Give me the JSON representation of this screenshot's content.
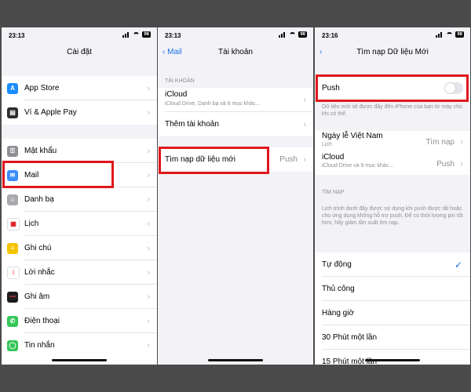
{
  "status": {
    "time_left": "23:13",
    "time_mid": "23:13",
    "time_right": "23:16",
    "battery": "98"
  },
  "settings": {
    "title": "Cài đặt",
    "group1": [
      {
        "label": "App Store",
        "icon": "app-store-icon",
        "color": "#1a8cff",
        "glyph": "A"
      },
      {
        "label": "Ví & Apple Pay",
        "icon": "wallet-icon",
        "color": "#2b2b2b",
        "glyph": "▤"
      }
    ],
    "group2": [
      {
        "label": "Mật khẩu",
        "icon": "key-icon",
        "color": "#8e8e93",
        "glyph": "⚿"
      },
      {
        "label": "Mail",
        "icon": "mail-icon",
        "color": "#3a8dff",
        "glyph": "✉"
      },
      {
        "label": "Danh bạ",
        "icon": "contacts-icon",
        "color": "#a8a8ad",
        "glyph": "☺"
      },
      {
        "label": "Lịch",
        "icon": "calendar-icon",
        "color": "#ffffff",
        "glyph": "▦"
      },
      {
        "label": "Ghi chú",
        "icon": "notes-icon",
        "color": "#f5c400",
        "glyph": "≡"
      },
      {
        "label": "Lời nhắc",
        "icon": "reminders-icon",
        "color": "#ffffff",
        "glyph": "⁝"
      },
      {
        "label": "Ghi âm",
        "icon": "voice-memos-icon",
        "color": "#1c1c1e",
        "glyph": "〰"
      },
      {
        "label": "Điện thoại",
        "icon": "phone-icon",
        "color": "#34c759",
        "glyph": "✆"
      },
      {
        "label": "Tin nhắn",
        "icon": "messages-icon",
        "color": "#34c759",
        "glyph": "◯"
      }
    ]
  },
  "accounts": {
    "back": "Mail",
    "title": "Tài khoản",
    "section": "TÀI KHOẢN",
    "icloud_title": "iCloud",
    "icloud_sub": "iCloud Drive, Danh bạ và 8 mục khác...",
    "add_account": "Thêm tài khoản",
    "fetch_label": "Tìm nạp dữ liệu mới",
    "fetch_value": "Push"
  },
  "fetch": {
    "title": "Tìm nạp Dữ liệu Mới",
    "push_label": "Push",
    "push_desc": "Dữ liệu mới sẽ được đẩy đến iPhone của bạn từ máy chủ khi có thể.",
    "acc1_title": "Ngày lễ Việt Nam",
    "acc1_sub": "Lịch",
    "acc1_value": "Tìm nạp",
    "acc2_title": "iCloud",
    "acc2_sub": "iCloud Drive và 9 mục khác...",
    "acc2_value": "Push",
    "section": "TÌM NẠP",
    "schedule_desc": "Lịch trình dưới đây được sử dụng khi push được tắt hoặc cho ứng dụng không hỗ trợ push. Để có thời lượng pin tốt hơn, hãy giảm tần suất tìm nạp.",
    "options": [
      "Tự động",
      "Thủ công",
      "Hàng giờ",
      "30 Phút một lần",
      "15 Phút một lần"
    ],
    "selected": "Tự động"
  }
}
